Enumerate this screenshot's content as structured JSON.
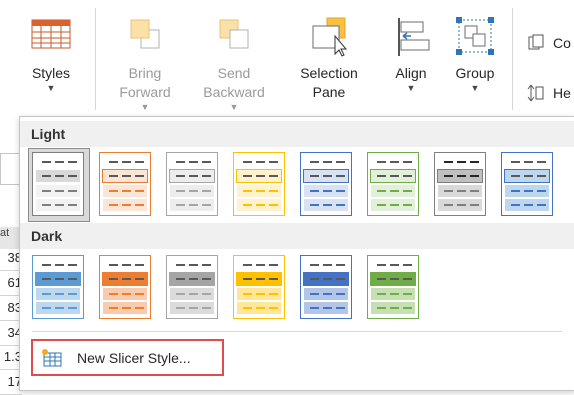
{
  "ribbon": {
    "styles_label": "Styles",
    "bring_forward_label": "Bring\nForward",
    "send_backward_label": "Send\nBackward",
    "selection_pane_label": "Selection\nPane",
    "align_label": "Align",
    "group_label": "Group",
    "co_label": "Co",
    "he_label": "He"
  },
  "sheet": {
    "header_fragment": "at",
    "cells": [
      "38",
      "61",
      "83",
      "34",
      "1.3",
      "17"
    ]
  },
  "panel": {
    "light_heading": "Light",
    "dark_heading": "Dark",
    "new_style_label": "New Slicer Style..."
  },
  "palette": {
    "light": [
      {
        "border": "#7f7f7f",
        "a": "#ffffff",
        "b": "#d9d9d9",
        "c": "#f2f2f2",
        "dash": "#595959",
        "selected": true
      },
      {
        "border": "#ed7d31",
        "a": "#ffffff",
        "b": "#fbe5d6",
        "c": "#fbe5d6",
        "dash": "#595959"
      },
      {
        "border": "#a5a5a5",
        "a": "#ffffff",
        "b": "#ededed",
        "c": "#ededed",
        "dash": "#595959"
      },
      {
        "border": "#ffc000",
        "a": "#ffffff",
        "b": "#fff2cc",
        "c": "#fff2cc",
        "dash": "#595959"
      },
      {
        "border": "#4472c4",
        "a": "#ffffff",
        "b": "#d9e2f3",
        "c": "#d9e2f3",
        "dash": "#595959"
      },
      {
        "border": "#70ad47",
        "a": "#ffffff",
        "b": "#e2efd9",
        "c": "#e2efd9",
        "dash": "#595959"
      },
      {
        "border": "#7f7f7f",
        "a": "#ffffff",
        "b": "#bfbfbf",
        "c": "#d9d9d9",
        "dash": "#262626"
      },
      {
        "border": "#4472c4",
        "a": "#ffffff",
        "b": "#bdd7ee",
        "c": "#bdd7ee",
        "dash": "#595959"
      }
    ],
    "dark": [
      {
        "border": "#5b9bd5",
        "a": "#ffffff",
        "b": "#5b9bd5",
        "c": "#bdd7ee",
        "dash": "#595959"
      },
      {
        "border": "#ed7d31",
        "a": "#ffffff",
        "b": "#ed7d31",
        "c": "#f8cbad",
        "dash": "#595959"
      },
      {
        "border": "#a5a5a5",
        "a": "#ffffff",
        "b": "#a5a5a5",
        "c": "#dbdbdb",
        "dash": "#595959"
      },
      {
        "border": "#ffc000",
        "a": "#ffffff",
        "b": "#ffc000",
        "c": "#ffe699",
        "dash": "#595959"
      },
      {
        "border": "#4472c4",
        "a": "#ffffff",
        "b": "#4472c4",
        "c": "#b4c6e7",
        "dash": "#595959"
      },
      {
        "border": "#70ad47",
        "a": "#ffffff",
        "b": "#70ad47",
        "c": "#c6e0b4",
        "dash": "#595959"
      }
    ],
    "accent_highlight": "#e04b4b"
  }
}
